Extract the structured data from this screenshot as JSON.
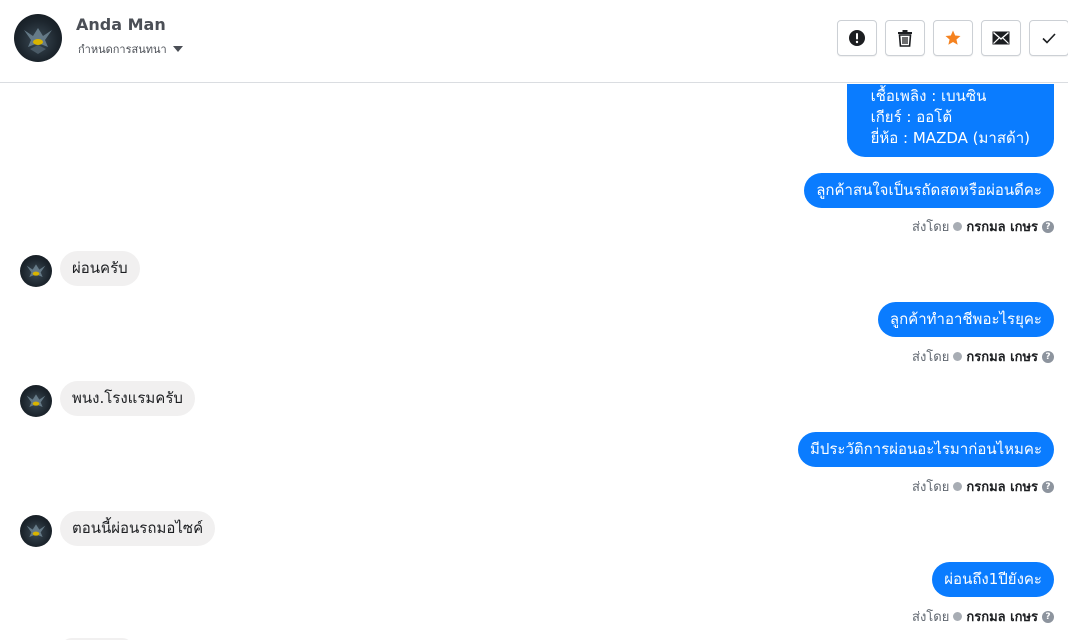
{
  "header": {
    "name": "Anda Man",
    "status": "กำหนดการสนทนา"
  },
  "icons": {
    "avatar": "avatar-image",
    "status_caret": "caret-down-icon",
    "actions": [
      "alert-icon",
      "trash-icon",
      "star-icon",
      "envelope-icon",
      "checkmark-icon"
    ],
    "sent_check": "check-circle-icon",
    "help": "help-icon"
  },
  "colors": {
    "outgoing_bubble": "#0a7cff",
    "incoming_bubble": "#f1f0f0",
    "star": "#f5821f"
  },
  "messages": {
    "car_info": {
      "line1": "เชื้อเพลิง : เบนซิน",
      "line2": "เกียร์ : ออโต้",
      "line3": "ยี่ห้อ : MAZDA (มาสด้า)"
    },
    "m1": "ลูกค้าสนใจเป็นรถัดสดหรือผ่อนดีคะ",
    "m2": "ผ่อนครับ",
    "m3": "ลูกค้าทำอาชีพอะไรยุคะ",
    "m4": "พนง.โรงแรมครับ",
    "m5": "มีประวัติการผ่อนอะไรมาก่อนไหมคะ",
    "m6": "ตอนนี้ผ่อนรถมอไซค์",
    "m7": "ผ่อนถึง1ปียังคะ"
  },
  "sent_by": {
    "label": "ส่งโดย",
    "agent": "กรกมล เกษร"
  }
}
